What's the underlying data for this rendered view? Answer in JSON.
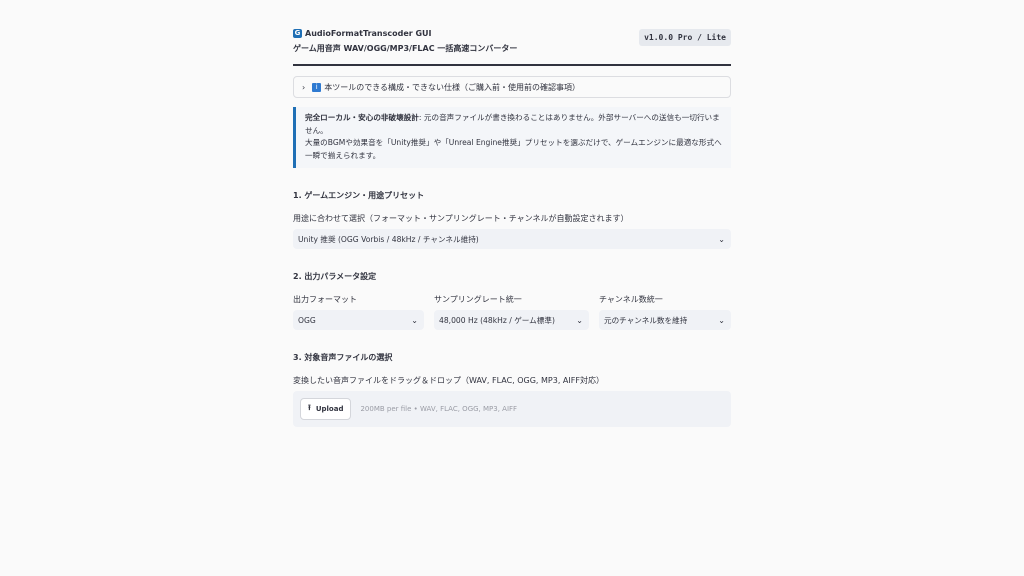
{
  "header": {
    "app_icon": "G",
    "app_title": "AudioFormatTranscoder GUI",
    "subtitle": "ゲーム用音声 WAV/OGG/MP3/FLAC 一括高速コンバーター",
    "version": "v1.0.0 Pro / Lite"
  },
  "expander": {
    "chevron": "›",
    "icon": "i",
    "label": "本ツールのできる構成・できない仕様（ご購入前・使用前の確認事項）"
  },
  "notice": {
    "bold": "完全ローカル・安心の非破壊設計",
    "line1": ": 元の音声ファイルが書き換わることはありません。外部サーバーへの送信も一切行いません。",
    "line2": "大量のBGMや効果音を「Unity推奨」や「Unreal Engine推奨」プリセットを選ぶだけで、ゲームエンジンに最適な形式へ一瞬で揃えられます。"
  },
  "section1": {
    "title": "1. ゲームエンジン・用途プリセット",
    "label": "用途に合わせて選択（フォーマット・サンプリングレート・チャンネルが自動設定されます）",
    "value": "Unity 推奨 (OGG Vorbis / 48kHz / チャンネル維持)"
  },
  "section2": {
    "title": "2. 出力パラメータ設定",
    "format_label": "出力フォーマット",
    "format_value": "OGG",
    "rate_label": "サンプリングレート統一",
    "rate_value": "48,000 Hz (48kHz / ゲーム標準)",
    "channel_label": "チャンネル数統一",
    "channel_value": "元のチャンネル数を維持"
  },
  "section3": {
    "title": "3. 対象音声ファイルの選択",
    "label": "変換したい音声ファイルをドラッグ＆ドロップ（WAV, FLAC, OGG, MP3, AIFF対応）",
    "upload_label": "Upload",
    "hint": "200MB per file • WAV, FLAC, OGG, MP3, AIFF"
  },
  "icons": {
    "chevron_down": "⌄",
    "upload": "⭱"
  },
  "colors": {
    "accent": "#1f6fb5",
    "background": "#fafafa",
    "input_bg": "#f0f2f6"
  }
}
